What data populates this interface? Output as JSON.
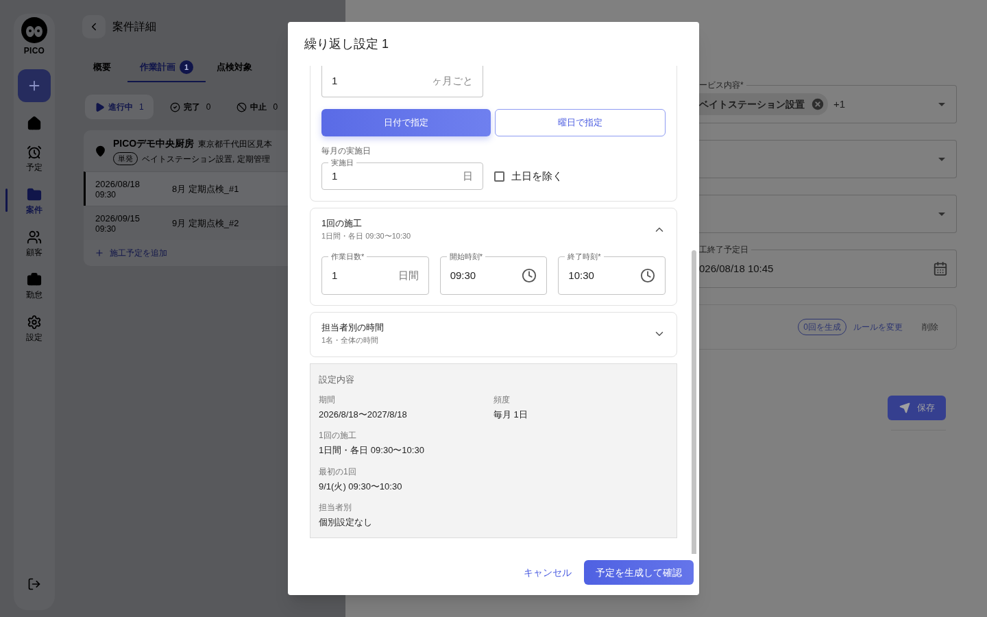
{
  "sidebar": {
    "logo": "PICO",
    "items": [
      {
        "kind": "add",
        "selected": false
      },
      {
        "kind": "home",
        "selected": false
      },
      {
        "kind": "schedule",
        "label": "予定",
        "selected": false
      },
      {
        "kind": "projects",
        "label": "案件",
        "selected": true
      },
      {
        "kind": "customers",
        "label": "顧客",
        "selected": false
      },
      {
        "kind": "attendance",
        "label": "勤怠",
        "selected": false
      },
      {
        "kind": "settings",
        "label": "設定",
        "selected": false
      }
    ]
  },
  "page": {
    "title": "案件詳細",
    "tabs": [
      {
        "label": "概要",
        "selected": false
      },
      {
        "label": "作業計画",
        "badge": "1",
        "selected": true
      },
      {
        "label": "点検対象",
        "selected": false
      }
    ],
    "status_filters": [
      {
        "kind": "in_progress",
        "label": "進行中",
        "count": "1",
        "selected": true
      },
      {
        "kind": "done",
        "label": "完了",
        "count": "0",
        "selected": false
      },
      {
        "kind": "cancelled",
        "label": "中止",
        "count": "0",
        "selected": false
      }
    ],
    "site": {
      "name": "PICOデモ中央厨房",
      "address": "東京都千代田区見本",
      "tag": "単発",
      "services": "ベイトステーション設置, 定期管理"
    },
    "schedules": [
      {
        "date": "2026/08/18",
        "time": "09:30",
        "title": "8月 定期点検_#1",
        "selected": true
      },
      {
        "date": "2026/09/15",
        "time": "09:30",
        "title": "9月 定期点検_#2",
        "selected": false
      }
    ],
    "add_link": "施工予定を追加"
  },
  "drawer": {
    "service_field": {
      "label": "ービス内容*",
      "chip": "ベイトステーション設置",
      "more": "+1"
    },
    "date_field": {
      "label": "工終了予定日",
      "value": "026/08/18 10:45"
    },
    "rule_actions": {
      "generate": "0回を生成",
      "change": "ルールを変更",
      "delete": "削除"
    },
    "save": "保存"
  },
  "modal": {
    "title": "繰り返し設定 1",
    "interval": {
      "value": "1",
      "suffix": "ヶ月ごと"
    },
    "modes": [
      {
        "label": "日付で指定",
        "selected": true
      },
      {
        "label": "曜日で指定",
        "selected": false
      }
    ],
    "monthly": {
      "caption": "毎月の実施日",
      "label": "実施日",
      "value": "1",
      "suffix": "日"
    },
    "exclude_weekends": {
      "label": "土日を除く",
      "checked": false
    },
    "session": {
      "title": "1回の施工",
      "summary": "1日間・各日 09:30〜10:30",
      "expanded": true,
      "fields": [
        {
          "kind": "number",
          "label": "作業日数*",
          "value": "1",
          "suffix": "日間"
        },
        {
          "kind": "time",
          "label": "開始時刻*",
          "value": "09:30"
        },
        {
          "kind": "time",
          "label": "終了時刻*",
          "value": "10:30"
        }
      ]
    },
    "assignee": {
      "title": "担当者別の時間",
      "summary": "1名・全体の時間",
      "expanded": false
    },
    "summary": {
      "title": "設定内容",
      "items": [
        {
          "label": "期間",
          "value": "2026/8/18〜2027/8/18"
        },
        {
          "label": "頻度",
          "value": "毎月 1日"
        },
        {
          "label": "1回の施工",
          "value": "1日間・各日 09:30〜10:30"
        },
        {
          "label": "最初の1回",
          "value": "9/1(火) 09:30〜10:30"
        },
        {
          "label": "担当者別",
          "value": "個別設定なし"
        }
      ]
    },
    "cancel": "キャンセル",
    "confirm": "予定を生成して確認"
  }
}
